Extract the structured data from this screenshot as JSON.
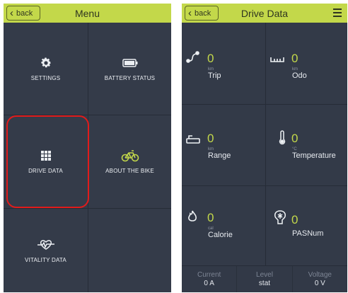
{
  "menu_screen": {
    "back_label": "back",
    "title": "Menu",
    "items": [
      {
        "label": "SETTINGS",
        "icon": "gear-icon"
      },
      {
        "label": "BATTERY STATUS",
        "icon": "battery-icon"
      },
      {
        "label": "DRIVE DATA",
        "icon": "grid-icon"
      },
      {
        "label": "ABOUT THE BIKE",
        "icon": "bike-icon"
      },
      {
        "label": "VITALITY DATA",
        "icon": "heart-pulse-icon"
      }
    ],
    "highlight_color": "#e21b1b"
  },
  "drive_screen": {
    "back_label": "back",
    "title": "Drive Data",
    "metrics": [
      {
        "value": "0",
        "unit": "km",
        "label": "Trip",
        "icon": "route-icon"
      },
      {
        "value": "0",
        "unit": "km",
        "label": "Odo",
        "icon": "ruler-icon"
      },
      {
        "value": "0",
        "unit": "km",
        "label": "Range",
        "icon": "range-icon"
      },
      {
        "value": "0",
        "unit": "°C",
        "label": "Temperature",
        "icon": "thermometer-icon"
      },
      {
        "value": "0",
        "unit": "cal",
        "label": "Calorie",
        "icon": "flame-icon"
      },
      {
        "value": "0",
        "unit": "",
        "label": "PASNum",
        "icon": "pas-icon"
      }
    ],
    "bottom": [
      {
        "label": "Current",
        "value": "0 A"
      },
      {
        "label": "Level",
        "value": "stat"
      },
      {
        "label": "Voltage",
        "value": "0 V"
      }
    ]
  },
  "colors": {
    "accent": "#c3d84a",
    "panel": "#333a48",
    "divider": "#262c37"
  }
}
